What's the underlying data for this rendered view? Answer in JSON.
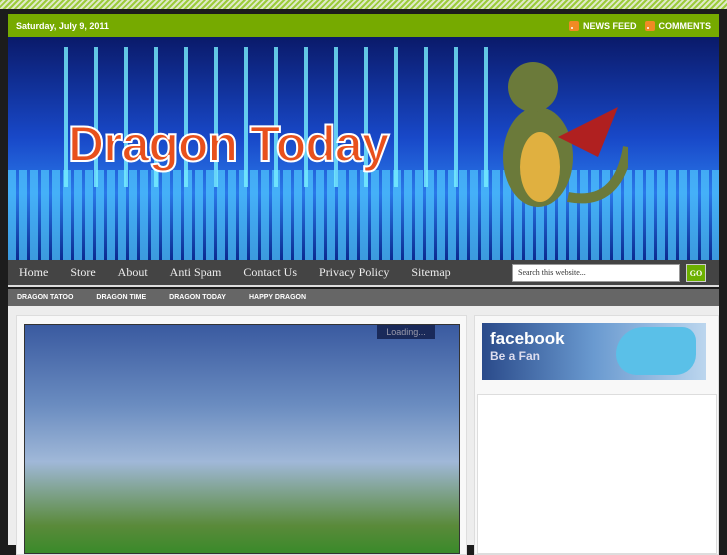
{
  "topbar": {
    "date": "Saturday, July 9, 2011",
    "news_feed": "NEWS FEED",
    "comments": "COMMENTS"
  },
  "header": {
    "title": "Dragon Today"
  },
  "nav": {
    "items": [
      "Home",
      "Store",
      "About",
      "Anti Spam",
      "Contact Us",
      "Privacy Policy",
      "Sitemap"
    ],
    "search_placeholder": "Search this website...",
    "go": "GO"
  },
  "subnav": {
    "items": [
      "DRAGON TATOO",
      "DRAGON TIME",
      "DRAGON TODAY",
      "HAPPY DRAGON"
    ]
  },
  "slider": {
    "loading": "Loading..."
  },
  "sidebar": {
    "facebook": "facebook",
    "be_a_fan": "Be a Fan"
  }
}
